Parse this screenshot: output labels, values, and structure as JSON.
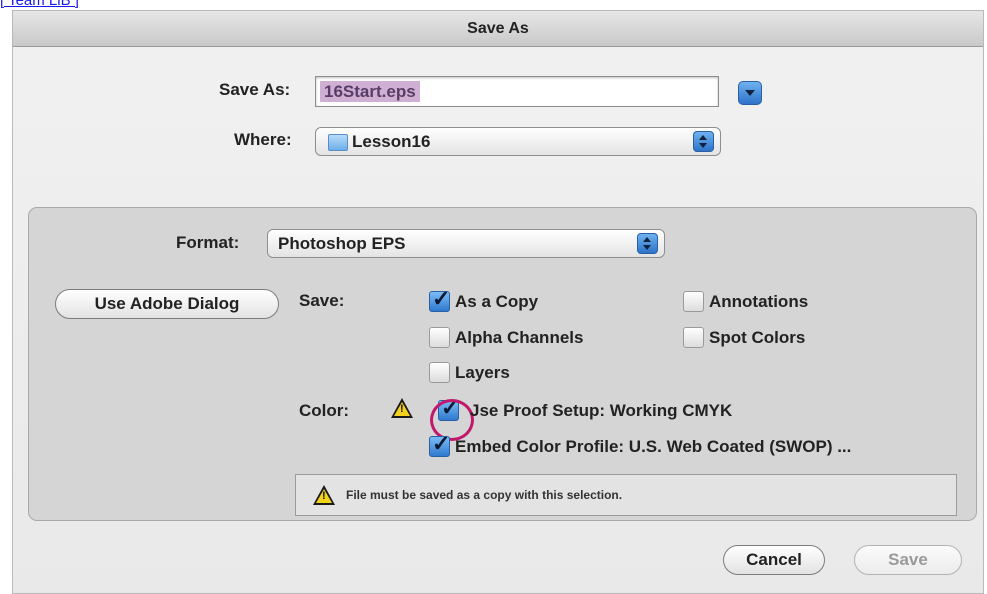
{
  "page": {
    "top_link": "[ Team LiB ]"
  },
  "dialog": {
    "title": "Save As",
    "save_as_label": "Save As:",
    "filename": "16Start.eps",
    "where_label": "Where:",
    "where_value": "Lesson16",
    "format_label": "Format:",
    "format_value": "Photoshop EPS",
    "use_adobe_dialog": "Use Adobe Dialog",
    "save_label": "Save:",
    "options": {
      "as_a_copy": {
        "label": "As a Copy",
        "checked": true
      },
      "annotations": {
        "label": "Annotations",
        "checked": false
      },
      "alpha_channels": {
        "label": "Alpha Channels",
        "checked": false
      },
      "spot_colors": {
        "label": "Spot Colors",
        "checked": false
      },
      "layers": {
        "label": "Layers",
        "checked": false
      }
    },
    "color_label": "Color:",
    "use_proof_setup": {
      "label": "Jse Proof Setup:  Working CMYK",
      "checked": true
    },
    "embed_color_profile": {
      "label": "Embed Color Profile:  U.S. Web Coated (SWOP) ...",
      "checked": true
    },
    "warning_message": "File must be saved as a copy with this selection.",
    "cancel": "Cancel",
    "save": "Save",
    "colors": {
      "highlight": "#cfb0d4",
      "accent": "#2d73c9",
      "annotation_ring": "#c2186b"
    }
  }
}
